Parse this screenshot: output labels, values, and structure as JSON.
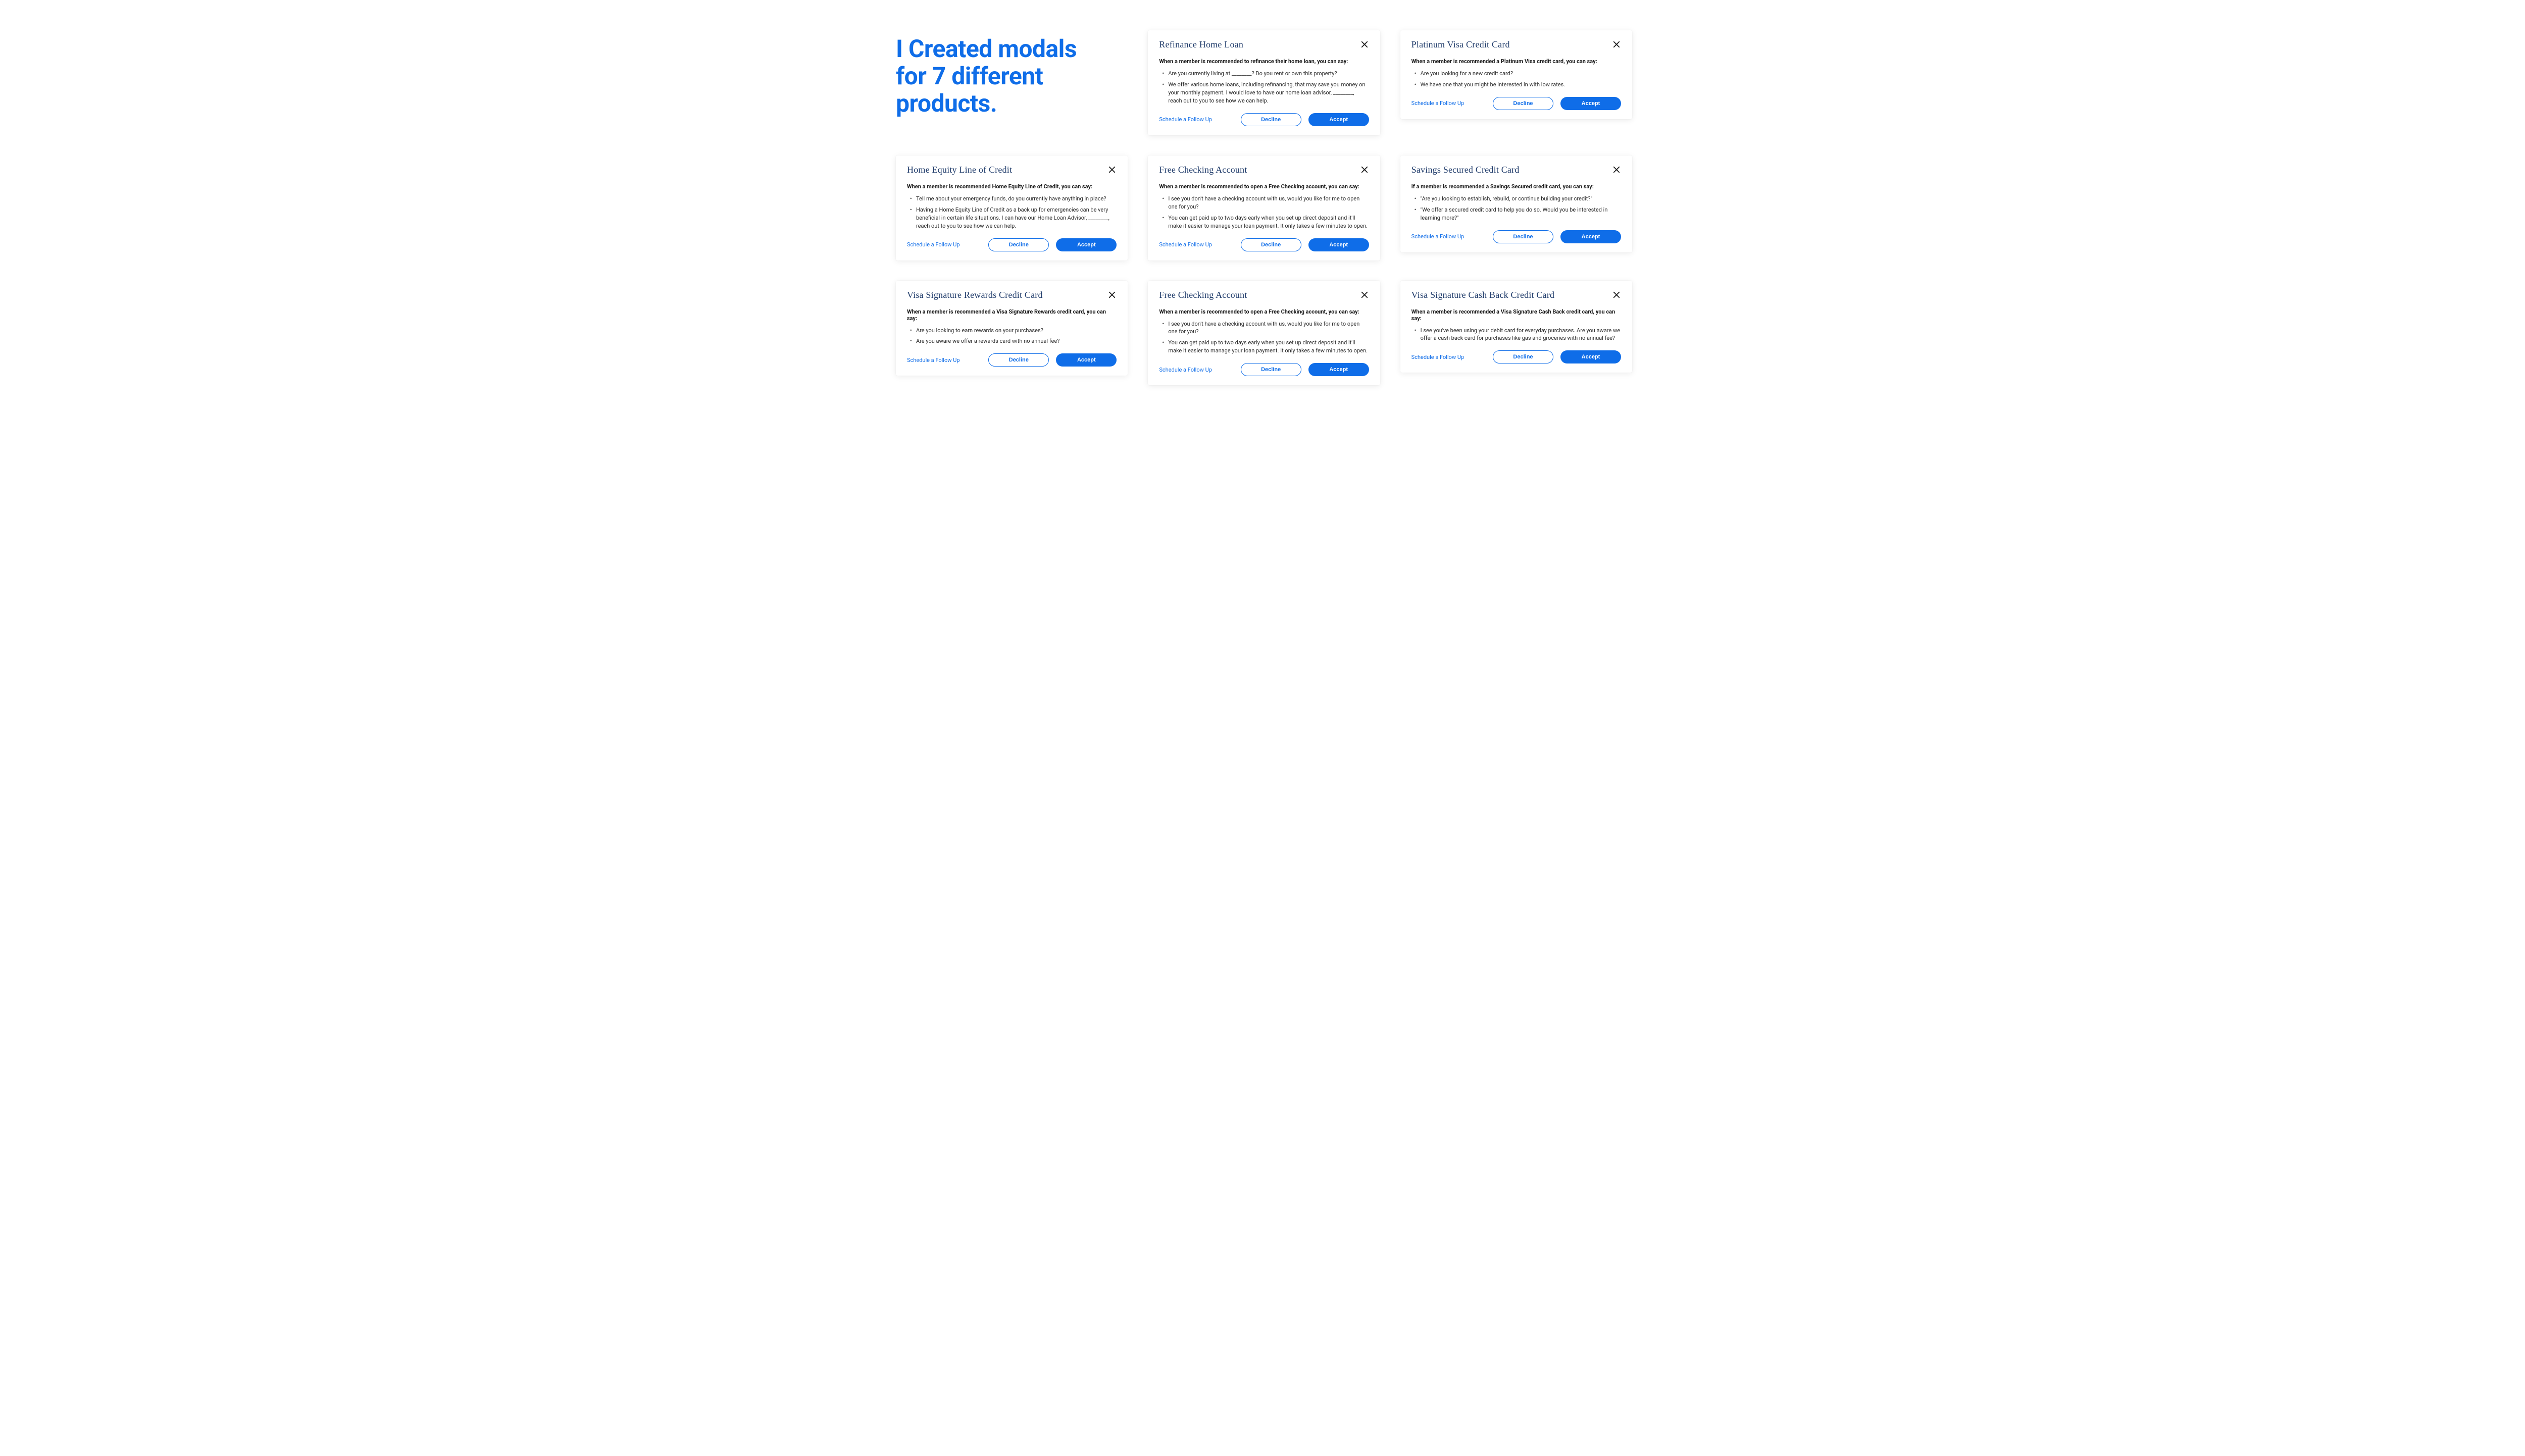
{
  "headline": "I Created modals for 7 different products.",
  "common": {
    "schedule": "Schedule a Follow Up",
    "decline": "Decline",
    "accept": "Accept"
  },
  "grid": [
    [
      {
        "type": "headline"
      },
      {
        "type": "modal",
        "title": "Refinance Home Loan",
        "prompt": "When a member is recommended to refinance their home loan, you can say:",
        "points": [
          "Are you currently living at ________? Do you rent or own this property?",
          "We offer various home loans, including refinancing, that may save you money on your monthly payment. I would love to have our home loan advisor, ________, reach out to you to see how we can help."
        ]
      },
      {
        "type": "modal",
        "title": "Platinum Visa Credit Card",
        "prompt": "When a member is recommended a Platinum Visa credit card, you can say:",
        "points": [
          "Are you looking for a new credit card?",
          "We have one that you might be interested in with low rates."
        ]
      }
    ],
    [
      {
        "type": "modal",
        "title": "Home Equity Line of Credit",
        "prompt": "When a member is recommended Home Equity Line of Credit, you can say:",
        "points": [
          "Tell me about your emergency funds, do you currently have anything in place?",
          "Having a Home Equity Line of Credit as a back up for emergencies can be very beneficial in certain life situations. I can have our Home Loan Advisor, ________, reach out to you to see how we can help."
        ]
      },
      {
        "type": "modal",
        "title": "Free Checking Account",
        "prompt": "When a member is recommended to open a Free Checking account, you can say:",
        "points": [
          "I see you don't have a checking account with us, would you like for me to open one for you?",
          "You can get paid up to two days early when you set up direct deposit and it'll make it easier to manage your loan payment. It only takes a few minutes to open."
        ]
      },
      {
        "type": "modal",
        "title": "Savings Secured Credit Card",
        "prompt": "If a member is recommended a Savings Secured credit card, you can say:",
        "points": [
          "\"Are you looking to establish, rebuild, or continue building your credit?\"",
          "\"We offer a secured credit card to help you do so. Would you be interested in learning more?\""
        ]
      }
    ],
    [
      {
        "type": "modal",
        "title": "Visa Signature  Rewards Credit Card",
        "prompt": "When a member is recommended a Visa Signature Rewards credit card, you can say:",
        "points": [
          "Are you looking to earn rewards on your purchases?",
          "Are you aware we offer a rewards card with no annual fee?"
        ]
      },
      {
        "type": "modal",
        "title": "Free Checking Account",
        "prompt": "When a member is recommended to open a Free Checking account, you can say:",
        "points": [
          "I see you don't have a checking account with us, would you like for me to open one for you?",
          "You can get paid up to two days early when you set up direct deposit and it'll make it easier to manage your loan payment. It only takes a few minutes to open."
        ]
      },
      {
        "type": "modal",
        "title": "Visa Signature Cash Back Credit Card",
        "prompt": "When a member is recommended a Visa Signature Cash Back credit card, you can say:",
        "points": [
          "I see you've been using your debit card for everyday purchases. Are you aware we offer a cash back card for purchases like gas and groceries with no annual fee?"
        ]
      }
    ]
  ]
}
